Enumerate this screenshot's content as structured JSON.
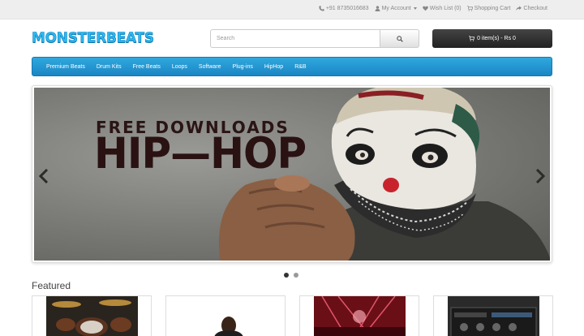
{
  "topbar": {
    "phone": "+91 8735016683",
    "my_account": "My Account",
    "wishlist": "Wish List (0)",
    "shopping_cart": "Shopping Cart",
    "checkout": "Checkout"
  },
  "header": {
    "logo": "MONSTERBEATS",
    "search_placeholder": "Search",
    "cart_label": "0 item(s) - Rs 0"
  },
  "nav": {
    "items": [
      "Premium Beats",
      "Drum Kits",
      "Free Beats",
      "Loops",
      "Software",
      "Plug-ins",
      "HipHop",
      "R&B"
    ]
  },
  "slider": {
    "line1": "FREE DOWNLOADS",
    "line2": "HIP—HOP",
    "active_slide": 1,
    "slide_count": 2
  },
  "featured": {
    "title": "Featured"
  },
  "colors": {
    "nav": "#1a86c4",
    "logo": "#2fb8f0",
    "cart": "#2b2b2b"
  }
}
